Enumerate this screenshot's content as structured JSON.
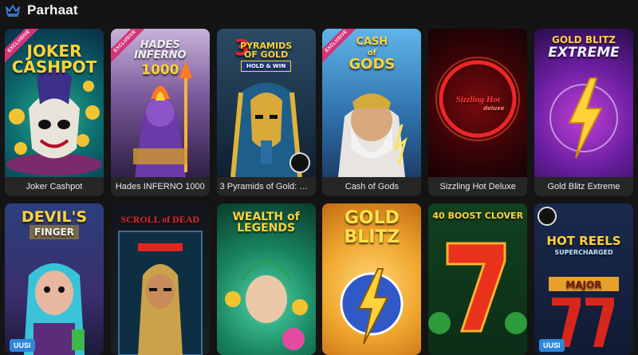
{
  "header": {
    "title": "Parhaat",
    "icon": "crown-icon",
    "accent": "#3b7fd9"
  },
  "rows": [
    [
      {
        "name": "Joker Cashpot",
        "logo": "JOKER CASHPOT",
        "ribbon": "EXCLUSIVE"
      },
      {
        "name": "Hades INFERNO 1000",
        "logo": "HADES INFERNO 1000",
        "ribbon": "EXCLUSIVE"
      },
      {
        "name": "3 Pyramids of Gold: H...",
        "logo": "3 PYRAMIDS OF GOLD",
        "sub": "HOLD & WIN"
      },
      {
        "name": "Cash of Gods",
        "logo": "CASH OF GODS",
        "ribbon": "EXCLUSIVE"
      },
      {
        "name": "Sizzling Hot Deluxe",
        "logo": "Sizzling Hot",
        "sub": "deluxe"
      },
      {
        "name": "Gold Blitz Extreme",
        "logo": "GOLD BLITZ",
        "sub": "EXTREME"
      }
    ],
    [
      {
        "name": "Devil's Finger",
        "logo": "DEVIL'S",
        "sub": "FINGER",
        "badge": "UUSI"
      },
      {
        "name": "Scroll of Dead",
        "logo": "SCROLL of DEAD"
      },
      {
        "name": "Wealth of Legends",
        "logo": "WEALTH of LEGENDS"
      },
      {
        "name": "Gold Blitz",
        "logo": "GOLD",
        "sub": "BLITZ"
      },
      {
        "name": "40 Boost Clover",
        "logo": "40 BOOST CLOVER"
      },
      {
        "name": "Hot Reels Supercharged",
        "logo": "HOT REELS",
        "sub": "SUPERCHARGED",
        "badge": "UUSI"
      }
    ]
  ]
}
